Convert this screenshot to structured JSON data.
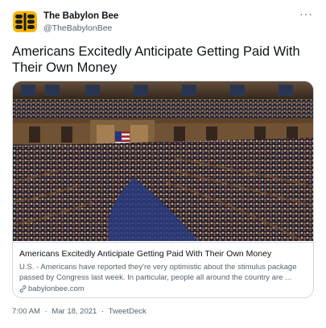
{
  "author": {
    "display_name": "The Babylon Bee",
    "handle": "@TheBabylonBee",
    "avatar_icon": "bee-logo-icon"
  },
  "more_icon": "more-options-icon",
  "more_label": "···",
  "tweet_text": "Americans Excitedly Anticipate Getting Paid With Their Own Money",
  "card": {
    "image": "house-chamber-photo",
    "title": "Americans Excitedly Anticipate Getting Paid With Their Own Money",
    "description": "U.S. - Americans have reported they're very optimistic about the stimulus package passed by Congress last week. In particular, people all around the country are ...",
    "domain_icon": "link-icon",
    "domain": "babylonbee.com"
  },
  "meta": {
    "time": "7:00 AM",
    "separator": "·",
    "date": "Mar 18, 2021",
    "client": "TweetDeck"
  },
  "colors": {
    "text": "#0f1419",
    "secondary": "#536471",
    "border": "#cfd9de",
    "avatar_yellow": "#f6b400"
  }
}
